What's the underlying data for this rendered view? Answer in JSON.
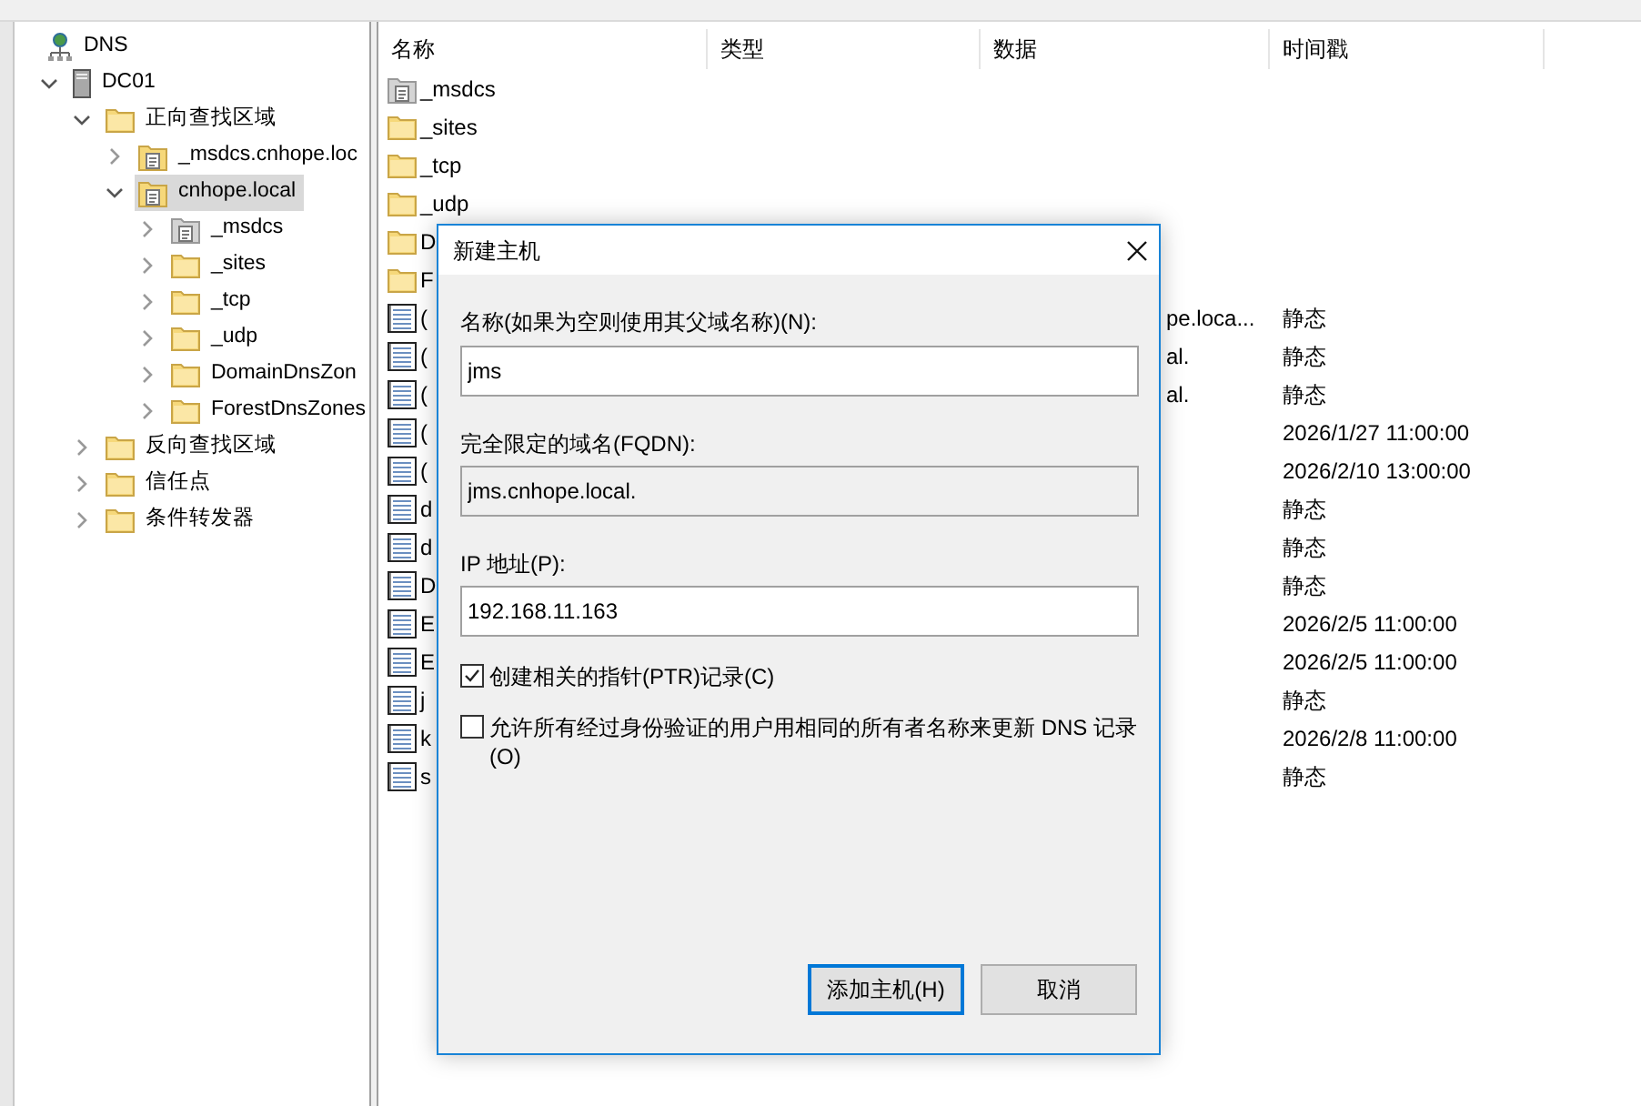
{
  "tree": [
    {
      "label": "DNS",
      "kind": "dns",
      "selected": false
    },
    {
      "label": "DC01",
      "kind": "server",
      "expanded": true,
      "selected": false,
      "children": [
        {
          "label": "正向查找区域",
          "kind": "folder",
          "expanded": true,
          "selected": false,
          "children": [
            {
              "label": "_msdcs.cnhope.loc",
              "kind": "zone",
              "expanded": false,
              "selected": false
            },
            {
              "label": "cnhope.local",
              "kind": "zone",
              "expanded": true,
              "selected": true,
              "children": [
                {
                  "label": "_msdcs",
                  "kind": "zone-grey",
                  "expanded": false,
                  "selected": false
                },
                {
                  "label": "_sites",
                  "kind": "folder",
                  "expanded": false,
                  "selected": false
                },
                {
                  "label": "_tcp",
                  "kind": "folder",
                  "expanded": false,
                  "selected": false
                },
                {
                  "label": "_udp",
                  "kind": "folder",
                  "expanded": false,
                  "selected": false
                },
                {
                  "label": "DomainDnsZon",
                  "kind": "folder",
                  "expanded": false,
                  "selected": false
                },
                {
                  "label": "ForestDnsZones",
                  "kind": "folder",
                  "expanded": false,
                  "selected": false
                }
              ]
            }
          ]
        },
        {
          "label": "反向查找区域",
          "kind": "folder",
          "expanded": false,
          "selected": false
        },
        {
          "label": "信任点",
          "kind": "folder",
          "expanded": false,
          "selected": false
        },
        {
          "label": "条件转发器",
          "kind": "folder",
          "expanded": false,
          "selected": false
        }
      ]
    }
  ],
  "list": {
    "columns": [
      "名称",
      "类型",
      "数据",
      "时间戳"
    ],
    "rows": [
      {
        "kind": "zone-grey",
        "name": "_msdcs"
      },
      {
        "kind": "folder",
        "name": "_sites"
      },
      {
        "kind": "folder",
        "name": "_tcp"
      },
      {
        "kind": "folder",
        "name": "_udp"
      },
      {
        "kind": "folder",
        "name": "D"
      },
      {
        "kind": "folder",
        "name": "F"
      },
      {
        "kind": "record",
        "name": "(",
        "data": "pe.loca...",
        "timestamp": "静态"
      },
      {
        "kind": "record",
        "name": "(",
        "data": "al.",
        "timestamp": "静态"
      },
      {
        "kind": "record",
        "name": "(",
        "data": "al.",
        "timestamp": "静态"
      },
      {
        "kind": "record",
        "name": "(",
        "timestamp": "2026/1/27 11:00:00"
      },
      {
        "kind": "record",
        "name": "(",
        "timestamp": "2026/2/10 13:00:00"
      },
      {
        "kind": "record",
        "name": "d",
        "timestamp": "静态"
      },
      {
        "kind": "record",
        "name": "d",
        "timestamp": "静态"
      },
      {
        "kind": "record",
        "name": "D",
        "timestamp": "静态"
      },
      {
        "kind": "record",
        "name": "E",
        "timestamp": "2026/2/5 11:00:00"
      },
      {
        "kind": "record",
        "name": "E",
        "timestamp": "2026/2/5 11:00:00"
      },
      {
        "kind": "record",
        "name": "j",
        "timestamp": "静态"
      },
      {
        "kind": "record",
        "name": "k",
        "timestamp": "2026/2/8 11:00:00"
      },
      {
        "kind": "record",
        "name": "s",
        "timestamp": "静态"
      }
    ]
  },
  "dialog": {
    "title": "新建主机",
    "name_label": "名称(如果为空则使用其父域名称)(N):",
    "name_value": "jms",
    "fqdn_label": "完全限定的域名(FQDN):",
    "fqdn_value": "jms.cnhope.local.",
    "ip_label": "IP 地址(P):",
    "ip_value": "192.168.11.163",
    "checkboxes": [
      {
        "label": "创建相关的指针(PTR)记录(C)",
        "checked": true
      },
      {
        "label": "允许所有经过身份验证的用户用相同的所有者名称来更新 DNS 记录(O)",
        "checked": false
      }
    ],
    "buttons": [
      {
        "label": "添加主机(H)",
        "default": true
      },
      {
        "label": "取消",
        "default": false
      }
    ]
  }
}
